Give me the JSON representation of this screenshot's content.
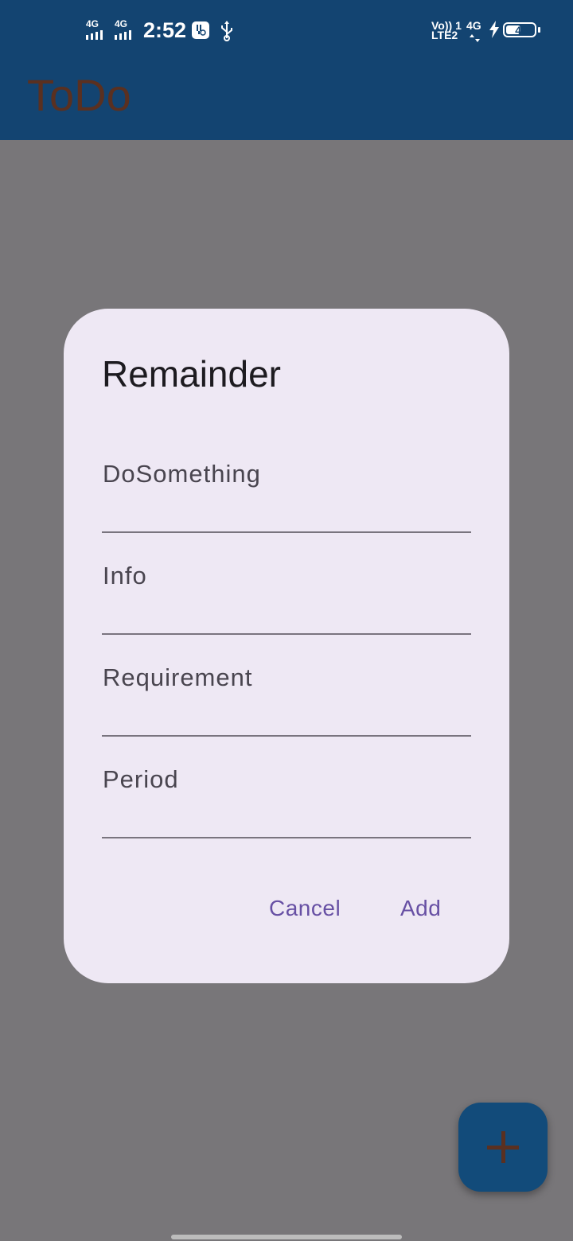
{
  "status_bar": {
    "time": "2:52",
    "sim1_network": "4G",
    "sim2_network": "4G",
    "volte_label": "Vo)) 1",
    "lte_label": "LTE2",
    "right_network": "4G",
    "battery_level": "43"
  },
  "app_bar": {
    "title": "ToDo"
  },
  "dialog": {
    "title": "Remainder",
    "fields": [
      {
        "label": "DoSomething",
        "value": ""
      },
      {
        "label": "Info",
        "value": ""
      },
      {
        "label": "Requirement",
        "value": ""
      },
      {
        "label": "Period",
        "value": ""
      }
    ],
    "cancel_label": "Cancel",
    "add_label": "Add"
  },
  "fab": {
    "icon": "plus-icon"
  },
  "colors": {
    "app_bar": "#134471",
    "scrim_background": "#787679",
    "dialog_surface": "#eee8f4",
    "button_text": "#6750a4",
    "title_text": "#5a3020",
    "fab": "#124b7a"
  }
}
